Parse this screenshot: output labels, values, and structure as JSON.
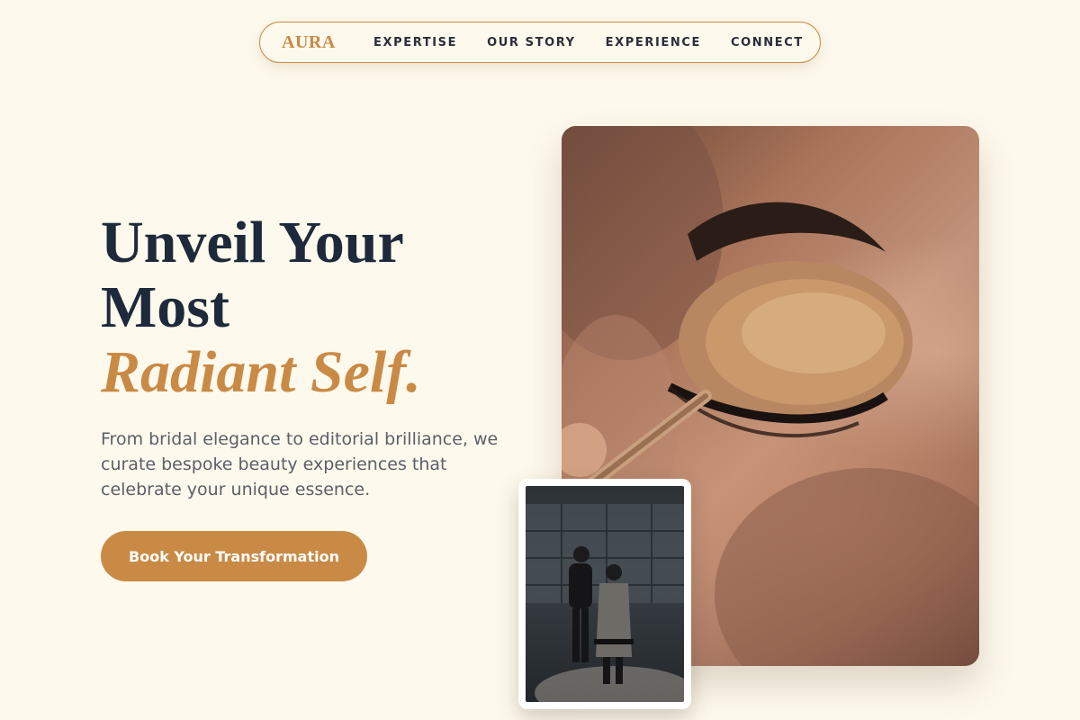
{
  "nav": {
    "brand": "AURA",
    "links": [
      "EXPERTISE",
      "OUR STORY",
      "EXPERIENCE",
      "CONNECT"
    ]
  },
  "hero": {
    "headline_line1": "Unveil Your",
    "headline_line2": "Most",
    "headline_accent": "Radiant Self.",
    "subtext": "From bridal elegance to editorial brilliance, we curate bespoke beauty experiences that celebrate your unique essence.",
    "cta_label": "Book Your Transformation",
    "main_image_alt": "Close-up of eyeshadow being applied with a brush",
    "inset_image_alt": "Makeup artist working on a client in a studio"
  },
  "colors": {
    "background": "#fdf9ec",
    "accent": "#c98a45",
    "heading": "#1e2a3b",
    "body_text": "#5a5f69"
  }
}
